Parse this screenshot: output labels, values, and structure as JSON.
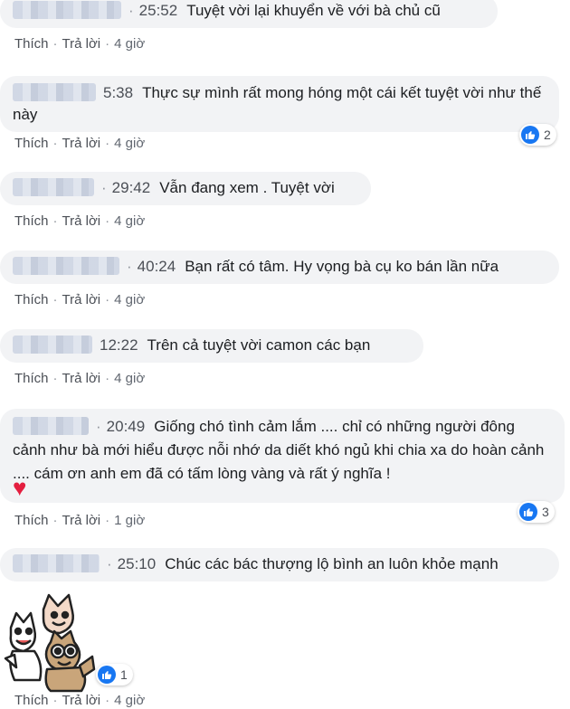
{
  "actions": {
    "like": "Thích",
    "reply": "Trả lời",
    "separator": "·"
  },
  "comments": [
    {
      "timestamp": "25:52",
      "text": "Tuyệt vời lại khuyển về với bà chủ cũ",
      "time_ago": "4 giờ"
    },
    {
      "timestamp": "5:38",
      "text": "Thực sự mình rất mong hóng một cái kết tuyệt vời như thế này",
      "time_ago": "4 giờ",
      "reactions": "2"
    },
    {
      "timestamp": "29:42",
      "text": "Vẫn đang xem . Tuyệt vời",
      "time_ago": "4 giờ"
    },
    {
      "timestamp": "40:24",
      "text": "Bạn rất có tâm. Hy vọng bà cụ ko bán lần nữa",
      "time_ago": "4 giờ"
    },
    {
      "timestamp": "12:22",
      "text": "Trên cả tuyệt vời camon các bạn",
      "time_ago": "4 giờ"
    },
    {
      "timestamp": "20:49",
      "text": "Giống chó tình cảm lắm .... chỉ có những người đông cảnh như bà mới hiểu được nỗi nhớ da diết khó ngủ khi chia xa do hoàn cảnh .... cám ơn anh em đã có tấm lòng vàng và rất ý nghĩa !",
      "time_ago": "1 giờ",
      "reactions": "3",
      "emoji": "heart"
    },
    {
      "timestamp": "25:10",
      "text": "Chúc các bác thượng lộ bình an luôn khỏe mạnh",
      "time_ago": "4 giờ",
      "reactions": "1",
      "sticker": "cartoon-cat-sticker"
    }
  ],
  "colors": {
    "bubble": "#f2f3f5",
    "like_blue": "#1877f2",
    "heart": "#e41e3f",
    "meta": "#616770"
  }
}
